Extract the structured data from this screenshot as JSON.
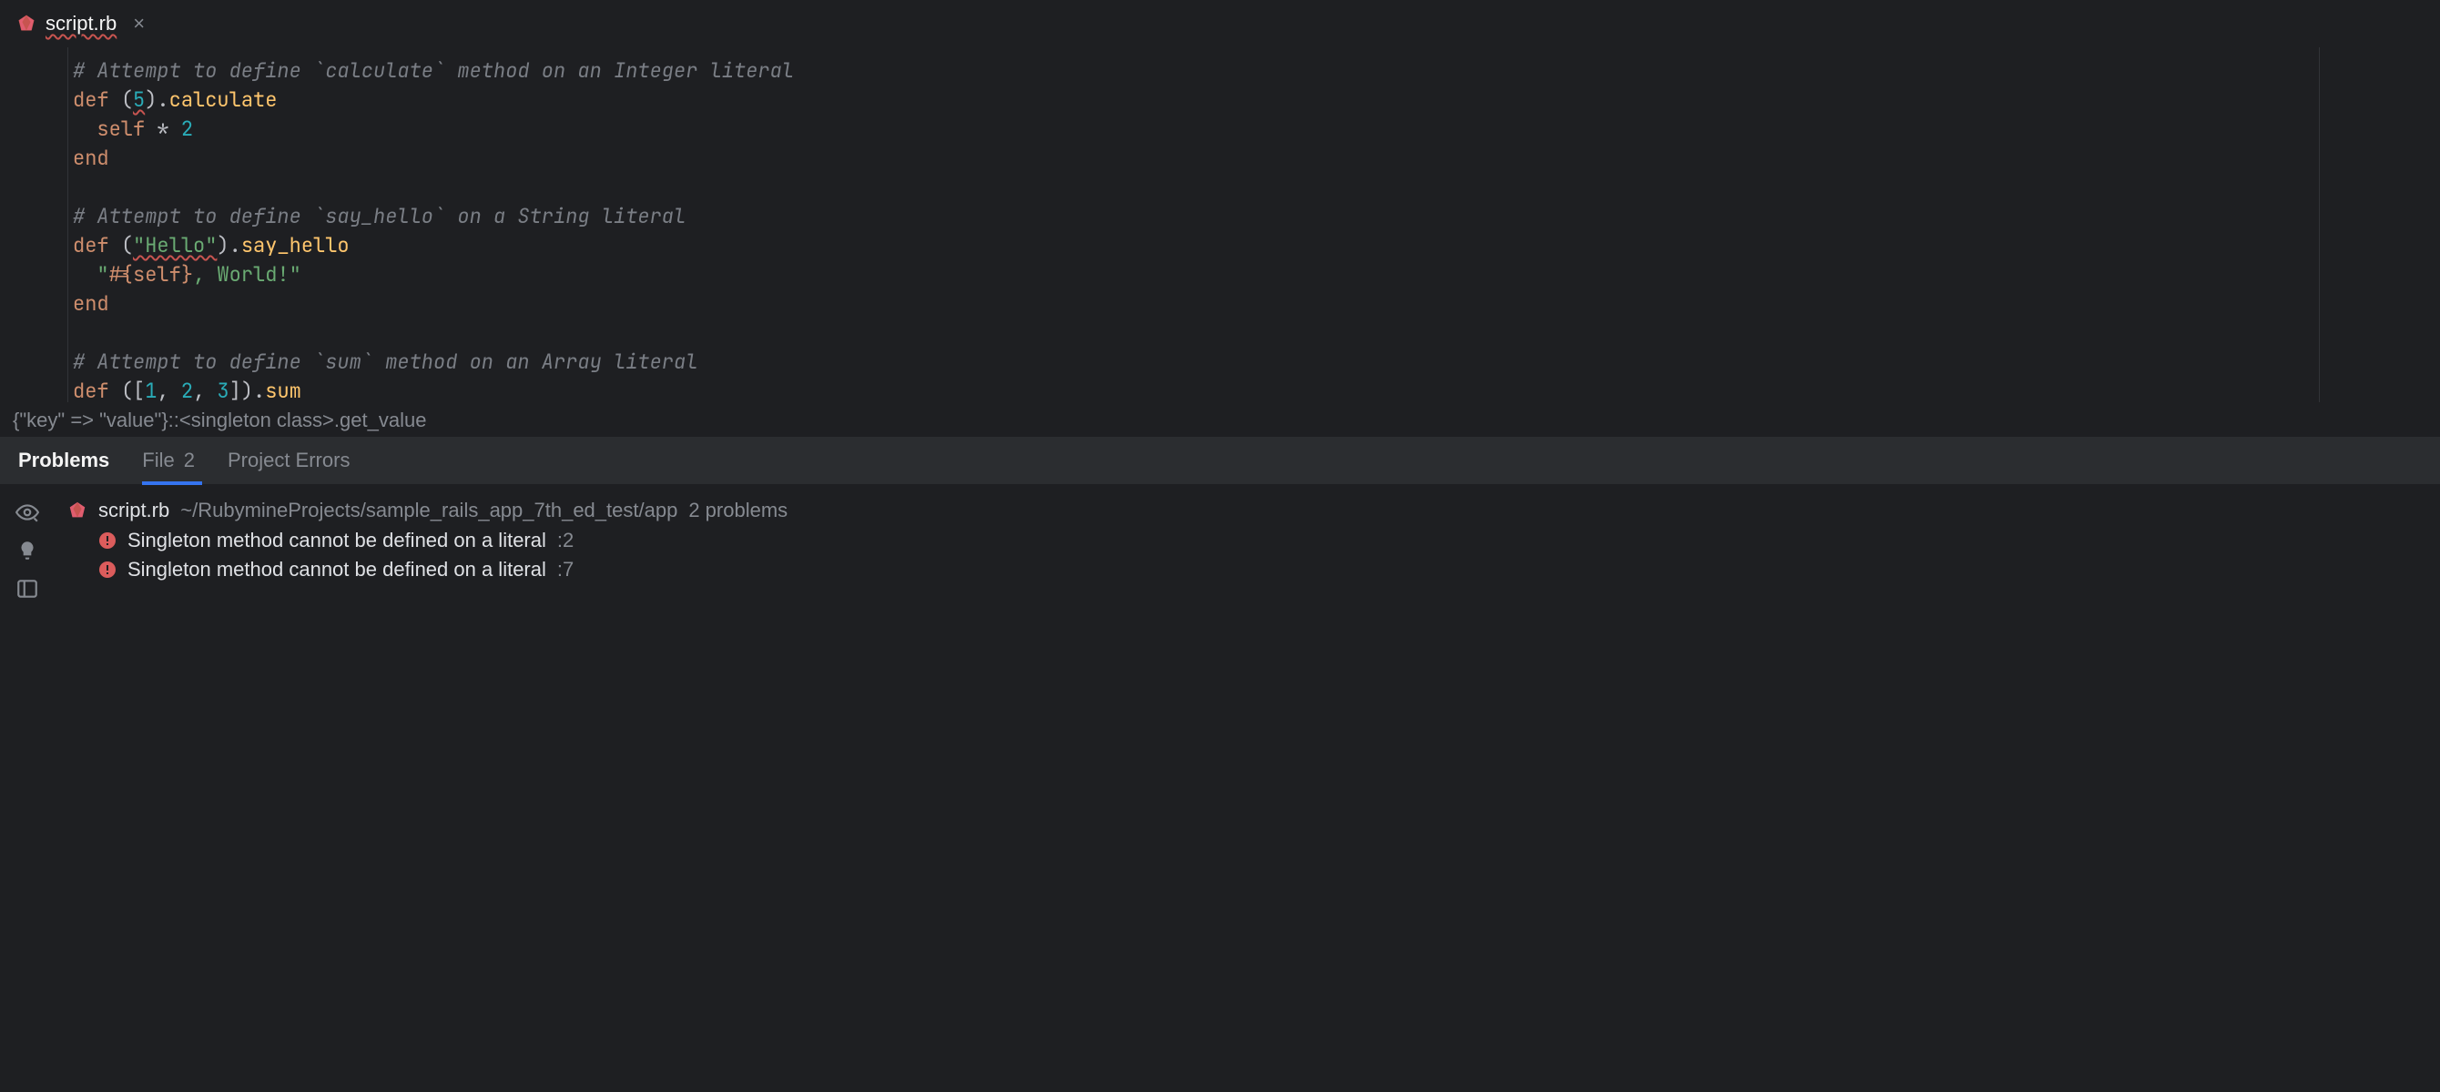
{
  "tab": {
    "filename": "script.rb"
  },
  "code": {
    "l1": "# Attempt to define `calculate` method on an Integer literal",
    "l2a": "def",
    "l2b": "(",
    "l2c": "5",
    "l2d": ").",
    "l2e": "calculate",
    "l3a": "self",
    "l3b": " * ",
    "l3c": "2",
    "l4": "end",
    "l6": "# Attempt to define `say_hello` on a String literal",
    "l7a": "def",
    "l7b": "(",
    "l7c": "\"Hello\"",
    "l7d": ").",
    "l7e": "say_hello",
    "l8a": "\"",
    "l8b": "#{",
    "l8c": "self",
    "l8d": "}",
    "l8e": ", World!",
    "l8f": "\"",
    "l9": "end",
    "l11": "# Attempt to define `sum` method on an Array literal",
    "l12a": "def",
    "l12b": "([",
    "l12c": "1",
    "l12d": ", ",
    "l12e": "2",
    "l12f": ", ",
    "l12g": "3",
    "l12h": "]).",
    "l12i": "sum"
  },
  "breadcrumb": "{\"key\" => \"value\"}::<singleton class>.get_value",
  "panel": {
    "problemsTab": "Problems",
    "fileTab": "File",
    "fileCount": "2",
    "projectErrorsTab": "Project Errors"
  },
  "problems": {
    "file": "script.rb",
    "path": "~/RubymineProjects/sample_rails_app_7th_ed_test/app",
    "count": "2 problems",
    "items": [
      {
        "msg": "Singleton method cannot be defined on a literal",
        "line": ":2"
      },
      {
        "msg": "Singleton method cannot be defined on a literal",
        "line": ":7"
      }
    ]
  }
}
